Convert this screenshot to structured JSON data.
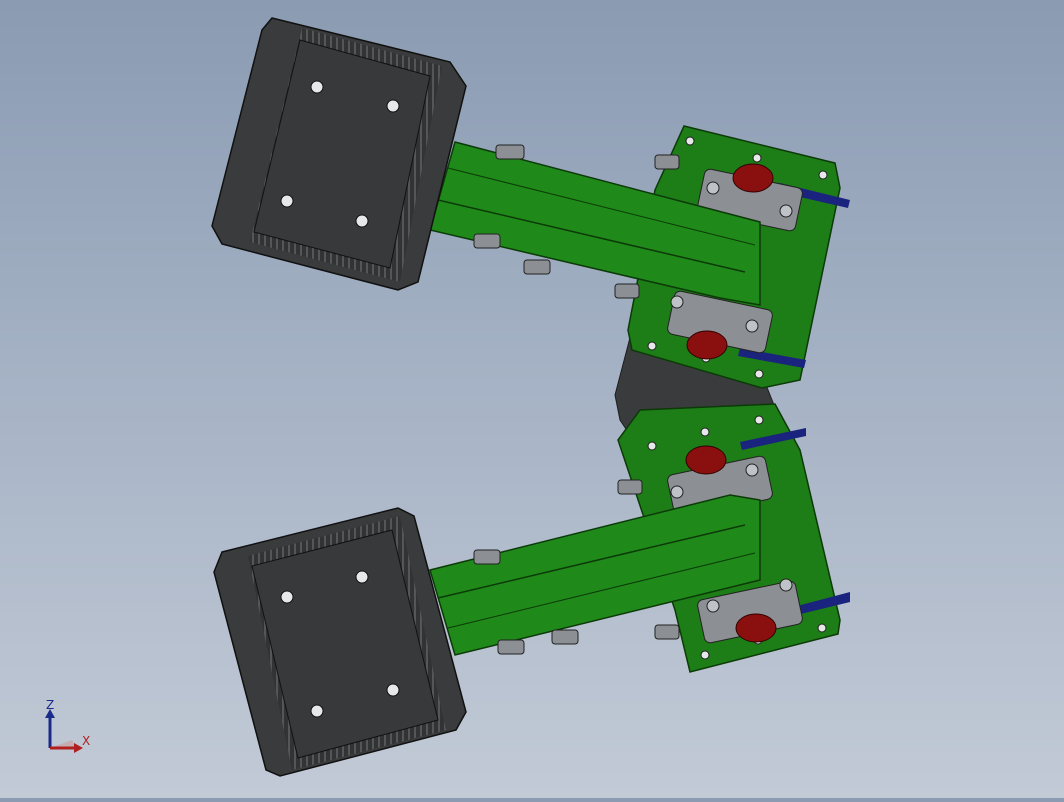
{
  "viewport": {
    "background_top": "#8a9bb2",
    "background_bottom": "#c2cad6",
    "part_colors": {
      "motor_body": "#3a3b3c",
      "arm_green": "#1f8a1a",
      "bracket_green": "#1d7d16",
      "cable_blue": "#1a237e",
      "bearing_red": "#8a1010",
      "bearing_grey": "#8c8f93"
    }
  },
  "triad": {
    "z_label": "Z",
    "x_label": "X",
    "z_color": "#1a2a8a",
    "x_color": "#b02020"
  }
}
